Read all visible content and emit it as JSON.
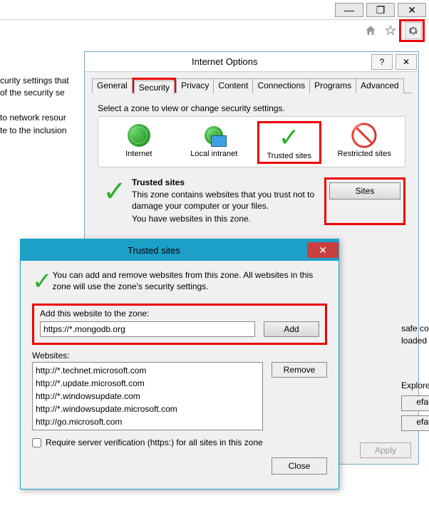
{
  "window_controls": {
    "minimize": "—",
    "maximize": "❐",
    "close": "✕"
  },
  "toolbar_icons": {
    "home": "home-icon",
    "favorites": "star-icon",
    "settings": "gear-icon"
  },
  "bg_text": "curity settings that\nof the security se\n\nto network resour\nte to the inclusion",
  "ioptions": {
    "title": "Internet Options",
    "help": "?",
    "close": "✕",
    "tabs": [
      "General",
      "Security",
      "Privacy",
      "Content",
      "Connections",
      "Programs",
      "Advanced"
    ],
    "active_tab": 1,
    "zone_prompt": "Select a zone to view or change security settings.",
    "zones": [
      {
        "key": "internet",
        "label": "Internet"
      },
      {
        "key": "local",
        "label": "Local intranet"
      },
      {
        "key": "trusted",
        "label": "Trusted sites"
      },
      {
        "key": "restricted",
        "label": "Restricted sites"
      }
    ],
    "trusted": {
      "heading": "Trusted sites",
      "desc1": "This zone contains websites that you trust not to damage your computer or your files.",
      "desc2": "You have websites in this zone.",
      "sites_btn": "Sites"
    },
    "partial": {
      "line1": "safe content",
      "line2": "loaded",
      "line3": "Explorer)",
      "btn1": "efault level",
      "btn2": "efault level"
    },
    "apply": "Apply"
  },
  "tsites": {
    "title": "Trusted sites",
    "close": "✕",
    "intro": "You can add and remove websites from this zone. All websites in this zone will use the zone's security settings.",
    "add_label": "Add this website to the zone:",
    "add_value": "https://*.mongodb.org",
    "add_btn": "Add",
    "list_label": "Websites:",
    "websites": [
      "http://*.technet.microsoft.com",
      "http://*.update.microsoft.com",
      "http://*.windowsupdate.com",
      "http://*.windowsupdate.microsoft.com",
      "http://go.microsoft.com"
    ],
    "remove_btn": "Remove",
    "require_label": "Require server verification (https:) for all sites in this zone",
    "close_btn": "Close"
  }
}
